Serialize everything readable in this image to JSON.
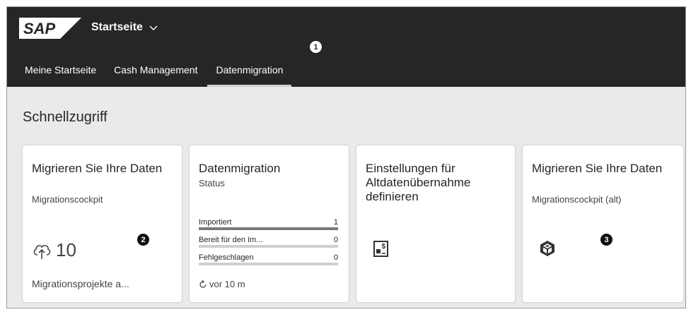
{
  "shell": {
    "logo": "SAP",
    "title": "Startseite",
    "tabs": [
      "Meine Startseite",
      "Cash Management",
      "Datenmigration"
    ],
    "active_tab": "Datenmigration"
  },
  "callouts": {
    "one": "1",
    "two": "2",
    "three": "3"
  },
  "section": {
    "title": "Schnellzugriff"
  },
  "tiles": [
    {
      "title": "Migrieren Sie Ihre Daten",
      "subtitle": "Migrationscockpit",
      "icon": "upload-cloud-icon",
      "kpi": "10",
      "footer": "Migrationsprojekte a..."
    },
    {
      "title": "Datenmigration",
      "subtitle": "Status",
      "status": [
        {
          "label": "Importiert",
          "value": "1",
          "fill": 1.0
        },
        {
          "label": "Bereit für den Im...",
          "value": "0",
          "fill": 0.0
        },
        {
          "label": "Fehlgeschlagen",
          "value": "0",
          "fill": 0.0
        }
      ],
      "refresh": "vor 10 m"
    },
    {
      "title": "Einstellungen für Altdatenübernahme definieren",
      "icon": "document-dollar-icon"
    },
    {
      "title": "Migrieren Sie Ihre Daten",
      "subtitle": "Migrationscockpit (alt)",
      "icon": "cube-icon"
    }
  ],
  "colors": {
    "shell_bg": "#262626",
    "page_bg": "#eaeaea",
    "tile_bg": "#ffffff",
    "bar_fill": "#7a7a7a",
    "bar_empty": "#cfcfcf"
  }
}
